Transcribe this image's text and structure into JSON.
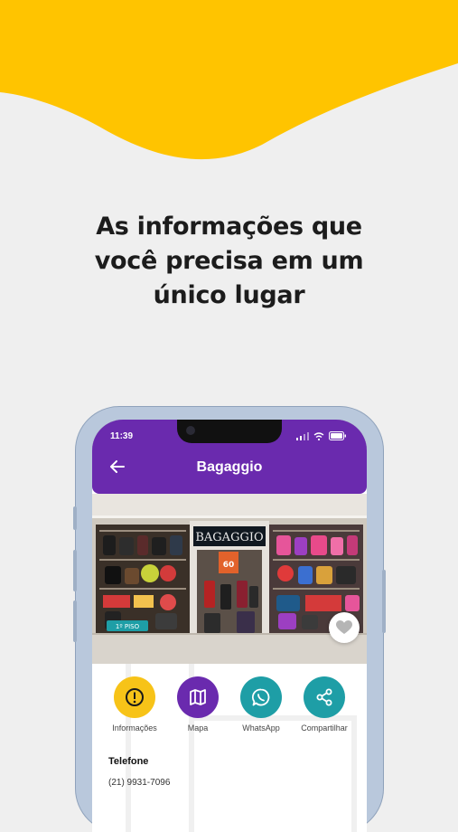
{
  "colors": {
    "brand_yellow": "#FFC400",
    "background": "#EFEFEF",
    "app_purple": "#6A2AAE",
    "info_yellow": "#F7C318",
    "map_purple": "#6A2AAE",
    "whatsapp_teal": "#1E9EA6",
    "share_teal": "#1E9EA6"
  },
  "headline": {
    "line1": "As informações que",
    "line2": "você precisa em um",
    "line3": "único lugar"
  },
  "status_bar": {
    "time": "11:39"
  },
  "app_header": {
    "title": "Bagaggio",
    "back_icon": "arrow-left-icon"
  },
  "store_image": {
    "sign": "BAGAGGIO",
    "floor_badge": "1º PISO",
    "promo_tag": "60"
  },
  "actions": [
    {
      "label": "Informações",
      "icon": "info-icon"
    },
    {
      "label": "Mapa",
      "icon": "map-icon"
    },
    {
      "label": "WhatsApp",
      "icon": "whatsapp-icon"
    },
    {
      "label": "Compartilhar",
      "icon": "share-icon"
    }
  ],
  "contact": {
    "phone_label": "Telefone",
    "phone_value": "(21) 9931-7096"
  }
}
